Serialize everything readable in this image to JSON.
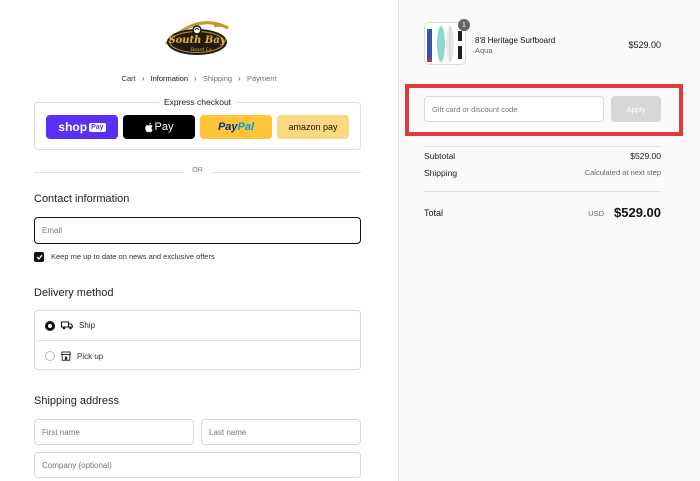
{
  "brand": {
    "name": "South Bay",
    "sub": "Board Co.",
    "primary_color": "#1f1a17",
    "accent_color": "#f0b429"
  },
  "breadcrumb": {
    "cart": "Cart",
    "information": "Information",
    "shipping": "Shipping",
    "payment": "Payment"
  },
  "express": {
    "title": "Express checkout",
    "shop_pay": "shop",
    "shop_pay_box": "Pay",
    "apple_pay": "Pay",
    "paypal_a": "Pay",
    "paypal_b": "Pal",
    "amazon_pay": "amazon pay"
  },
  "or_label": "OR",
  "contact": {
    "title": "Contact information",
    "email_placeholder": "Email",
    "newsletter_label": "Keep me up to date on news and exclusive offers",
    "newsletter_checked": true
  },
  "delivery": {
    "title": "Delivery method",
    "options": [
      {
        "label": "Ship",
        "selected": true
      },
      {
        "label": "Pick up",
        "selected": false
      }
    ]
  },
  "shipping_address": {
    "title": "Shipping address",
    "first_name_placeholder": "First name",
    "last_name_placeholder": "Last name",
    "company_placeholder": "Company (optional)"
  },
  "cart": {
    "item": {
      "name": "8'8 Heritage Surfboard",
      "variant": "Aqua",
      "price": "$529.00",
      "quantity": "1"
    },
    "discount_placeholder": "Gift card or discount code",
    "apply_label": "Apply",
    "subtotal_label": "Subtotal",
    "subtotal_value": "$529.00",
    "shipping_label": "Shipping",
    "shipping_value": "Calculated at next step",
    "total_label": "Total",
    "total_currency": "USD",
    "total_value": "$529.00",
    "highlight_color": "#e0393e"
  }
}
